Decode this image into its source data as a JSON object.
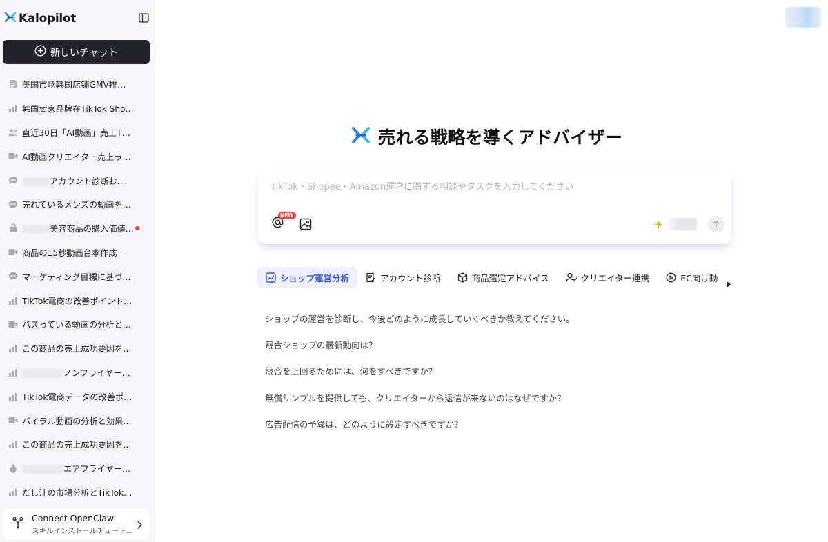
{
  "brand": {
    "name": "Kalopilot"
  },
  "sidebar": {
    "new_chat_label": "新しいチャット",
    "history": [
      {
        "icon": "document-icon",
        "prefix_blur": false,
        "text": "美国市场韩国店铺GMV排名…"
      },
      {
        "icon": "bar-chart-icon",
        "prefix_blur": false,
        "text": "韩国卖家品牌在TikTok Sho…"
      },
      {
        "icon": "users-icon",
        "prefix_blur": false,
        "text": "直近30日「AI動画」売上TO…"
      },
      {
        "icon": "video-icon",
        "prefix_blur": false,
        "text": "AI動画クリエイター売上ラ…"
      },
      {
        "icon": "chat-bubble-icon",
        "prefix_blur": true,
        "text": "アカウント診断お…"
      },
      {
        "icon": "chat-bubble-icon",
        "prefix_blur": false,
        "text": "売れているメンズの動画を3…"
      },
      {
        "icon": "shopping-bag-icon",
        "prefix_blur": true,
        "text": "美容商品の購入価値…",
        "dot": true
      },
      {
        "icon": "video-icon",
        "prefix_blur": false,
        "text": "商品の15秒動画台本作成"
      },
      {
        "icon": "chat-bubble-icon",
        "prefix_blur": false,
        "text": "マーケティング目標に基づ…"
      },
      {
        "icon": "bar-chart-icon",
        "prefix_blur": false,
        "text": "TikTok電商の改善ポイント…"
      },
      {
        "icon": "video-icon",
        "prefix_blur": false,
        "text": "バズっている動画の分析と…"
      },
      {
        "icon": "bar-chart-icon",
        "prefix_blur": false,
        "text": "この商品の売上成功要因を…"
      },
      {
        "icon": "bar-chart-icon",
        "prefix_blur": true,
        "text": "ノンフライヤー…"
      },
      {
        "icon": "bar-chart-icon",
        "prefix_blur": false,
        "text": "TikTok電商データの改善ポ…"
      },
      {
        "icon": "video-icon",
        "prefix_blur": false,
        "text": "バイラル動画の分析と効果…"
      },
      {
        "icon": "bar-chart-icon",
        "prefix_blur": false,
        "text": "この商品の売上成功要因を…"
      },
      {
        "icon": "fire-icon",
        "prefix_blur": true,
        "text": "エアフライヤー…"
      },
      {
        "icon": "bar-chart-icon",
        "prefix_blur": false,
        "text": "だし汁の市場分析とTikTok…"
      }
    ],
    "connect": {
      "title": "Connect OpenClaw",
      "subtitle": "スキルインストールチュートリアル"
    }
  },
  "main": {
    "hero_title": "売れる戦略を導くアドバイザー",
    "composer": {
      "placeholder": "TikTok・Shopee・Amazon運営に関する相談やタスクを入力してください",
      "new_badge": "NEW"
    },
    "tabs": [
      {
        "label": "ショップ運営分析",
        "icon": "shop-chart-icon",
        "active": true
      },
      {
        "label": "アカウント診断",
        "icon": "account-doc-icon",
        "active": false
      },
      {
        "label": "商品選定アドバイス",
        "icon": "box-icon",
        "active": false
      },
      {
        "label": "クリエイター連携",
        "icon": "creator-icon",
        "active": false
      },
      {
        "label": "EC向け動",
        "icon": "play-circle-icon",
        "active": false
      }
    ],
    "suggestions": [
      "ショップの運営を診断し、今後どのように成長していくべきか教えてください。",
      "競合ショップの最新動向は？",
      "競合を上回るためには、何をすべきですか？",
      "無償サンプルを提供しても、クリエイターから返信が来ないのはなぜですか？",
      "広告配信の予算は、どのように設定すべきですか？"
    ]
  },
  "colors": {
    "accent": "#3b5bdb",
    "dark_button": "#23232b",
    "badge_red": "#f04a4a",
    "sparkle": "#f5b100"
  }
}
